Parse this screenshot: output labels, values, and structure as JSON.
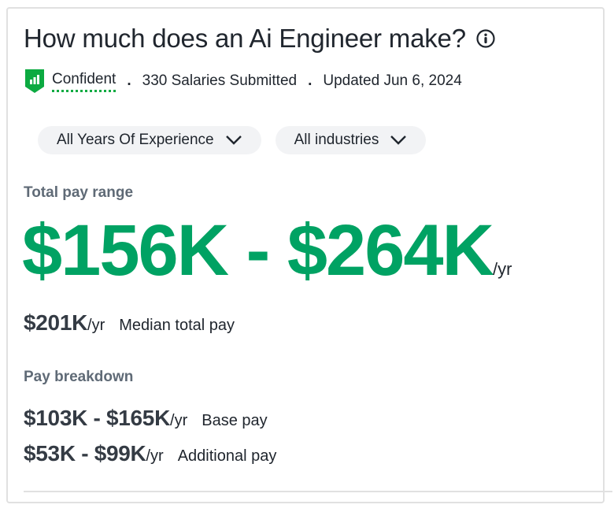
{
  "header": {
    "title": "How much does an Ai Engineer make?",
    "info_icon": "info-circle-icon"
  },
  "meta": {
    "confidence_icon": "shield-bar-chart-icon",
    "confidence": "Confident",
    "separator": ".",
    "salaries": "330 Salaries Submitted",
    "updated": "Updated Jun 6, 2024"
  },
  "filters": [
    {
      "label": "All Years Of Experience",
      "icon": "chevron-down-icon"
    },
    {
      "label": "All industries",
      "icon": "chevron-down-icon"
    }
  ],
  "total_pay": {
    "label": "Total pay range",
    "range": "$156K - $264K",
    "unit": "/yr"
  },
  "median": {
    "amount": "$201K",
    "unit": "/yr",
    "label": "Median total pay"
  },
  "breakdown": {
    "label": "Pay breakdown",
    "items": [
      {
        "range": "$103K - $165K",
        "unit": "/yr",
        "label": "Base pay"
      },
      {
        "range": "$53K - $99K",
        "unit": "/yr",
        "label": "Additional pay"
      }
    ]
  },
  "colors": {
    "accent_green": "#00a263",
    "badge_green": "#0caa41",
    "muted_label": "#5f6a76",
    "pill_bg": "#f2f3f5"
  }
}
